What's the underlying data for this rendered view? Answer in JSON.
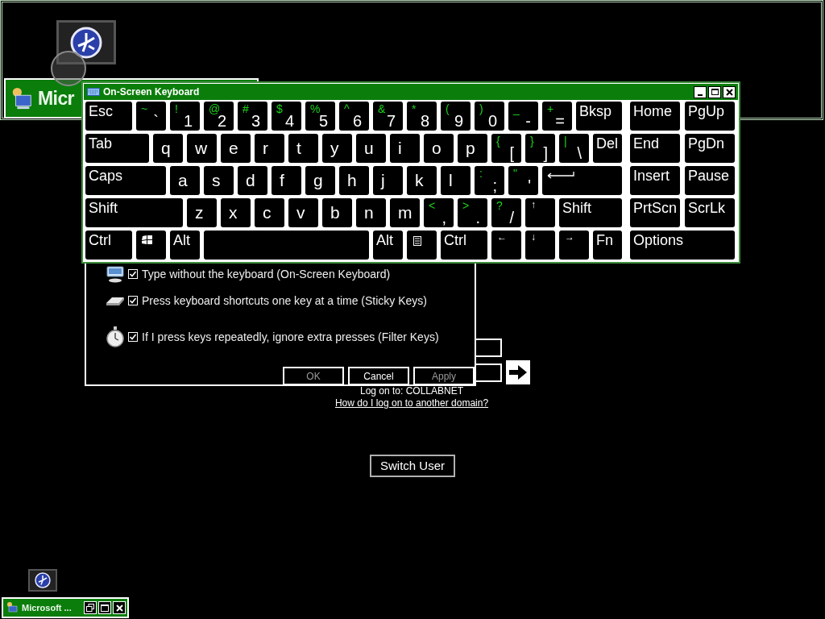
{
  "background_window": {
    "title": "Micr"
  },
  "keyboard": {
    "title": "On-Screen Keyboard",
    "rows": [
      {
        "keys": [
          {
            "kind": "label",
            "label": "Esc"
          },
          {
            "kind": "symbol",
            "shift": "~",
            "base": "`"
          },
          {
            "kind": "symbol",
            "shift": "!",
            "base": "1"
          },
          {
            "kind": "symbol",
            "shift": "@",
            "base": "2"
          },
          {
            "kind": "symbol",
            "shift": "#",
            "base": "3"
          },
          {
            "kind": "symbol",
            "shift": "$",
            "base": "4"
          },
          {
            "kind": "symbol",
            "shift": "%",
            "base": "5"
          },
          {
            "kind": "symbol",
            "shift": "^",
            "base": "6"
          },
          {
            "kind": "symbol",
            "shift": "&",
            "base": "7"
          },
          {
            "kind": "symbol",
            "shift": "*",
            "base": "8"
          },
          {
            "kind": "symbol",
            "shift": "(",
            "base": "9"
          },
          {
            "kind": "symbol",
            "shift": ")",
            "base": "0"
          },
          {
            "kind": "symbol",
            "shift": "_",
            "base": "-"
          },
          {
            "kind": "symbol",
            "shift": "+",
            "base": "="
          },
          {
            "kind": "label",
            "label": "Bksp"
          }
        ],
        "nav": [
          {
            "kind": "label",
            "label": "Home"
          },
          {
            "kind": "label",
            "label": "PgUp"
          }
        ]
      },
      {
        "keys": [
          {
            "kind": "label",
            "label": "Tab"
          },
          {
            "kind": "letter",
            "label": "q"
          },
          {
            "kind": "letter",
            "label": "w"
          },
          {
            "kind": "letter",
            "label": "e"
          },
          {
            "kind": "letter",
            "label": "r"
          },
          {
            "kind": "letter",
            "label": "t"
          },
          {
            "kind": "letter",
            "label": "y"
          },
          {
            "kind": "letter",
            "label": "u"
          },
          {
            "kind": "letter",
            "label": "i"
          },
          {
            "kind": "letter",
            "label": "o"
          },
          {
            "kind": "letter",
            "label": "p"
          },
          {
            "kind": "symbol",
            "shift": "{",
            "base": "["
          },
          {
            "kind": "symbol",
            "shift": "}",
            "base": "]"
          },
          {
            "kind": "symbol",
            "shift": "|",
            "base": "\\"
          },
          {
            "kind": "label",
            "label": "Del"
          }
        ],
        "nav": [
          {
            "kind": "label",
            "label": "End"
          },
          {
            "kind": "label",
            "label": "PgDn"
          }
        ]
      },
      {
        "keys": [
          {
            "kind": "label",
            "label": "Caps"
          },
          {
            "kind": "letter",
            "label": "a"
          },
          {
            "kind": "letter",
            "label": "s"
          },
          {
            "kind": "letter",
            "label": "d"
          },
          {
            "kind": "letter",
            "label": "f"
          },
          {
            "kind": "letter",
            "label": "g"
          },
          {
            "kind": "letter",
            "label": "h"
          },
          {
            "kind": "letter",
            "label": "j"
          },
          {
            "kind": "letter",
            "label": "k"
          },
          {
            "kind": "letter",
            "label": "l"
          },
          {
            "kind": "symbol",
            "shift": ":",
            "base": ";"
          },
          {
            "kind": "symbol",
            "shift": "\"",
            "base": "'"
          },
          {
            "kind": "enter"
          }
        ],
        "nav": [
          {
            "kind": "label",
            "label": "Insert"
          },
          {
            "kind": "label",
            "label": "Pause"
          }
        ]
      },
      {
        "keys": [
          {
            "kind": "label",
            "label": "Shift"
          },
          {
            "kind": "letter",
            "label": "z"
          },
          {
            "kind": "letter",
            "label": "x"
          },
          {
            "kind": "letter",
            "label": "c"
          },
          {
            "kind": "letter",
            "label": "v"
          },
          {
            "kind": "letter",
            "label": "b"
          },
          {
            "kind": "letter",
            "label": "n"
          },
          {
            "kind": "letter",
            "label": "m"
          },
          {
            "kind": "symbol",
            "shift": "<",
            "base": ","
          },
          {
            "kind": "symbol",
            "shift": ">",
            "base": "."
          },
          {
            "kind": "symbol",
            "shift": "?",
            "base": "/"
          },
          {
            "kind": "small",
            "label": "↑"
          },
          {
            "kind": "label",
            "label": "Shift"
          }
        ],
        "nav": [
          {
            "kind": "label",
            "label": "PrtScn"
          },
          {
            "kind": "label",
            "label": "ScrLk"
          }
        ]
      },
      {
        "keys": [
          {
            "kind": "label",
            "label": "Ctrl"
          },
          {
            "kind": "winlogo"
          },
          {
            "kind": "label",
            "label": "Alt"
          },
          {
            "kind": "space"
          },
          {
            "kind": "label",
            "label": "Alt"
          },
          {
            "kind": "menu"
          },
          {
            "kind": "label",
            "label": "Ctrl"
          },
          {
            "kind": "small",
            "label": "←"
          },
          {
            "kind": "small",
            "label": "↓"
          },
          {
            "kind": "small",
            "label": "→"
          },
          {
            "kind": "label",
            "label": "Fn"
          }
        ],
        "nav": [
          {
            "kind": "label",
            "label": "Options"
          }
        ]
      }
    ]
  },
  "ease_dialog": {
    "options": [
      {
        "kind": "keyboard",
        "label": "Type without the keyboard (On-Screen Keyboard)",
        "checked": true
      },
      {
        "kind": "sticky",
        "label": "Press keyboard shortcuts one key at a time (Sticky Keys)",
        "checked": true
      },
      {
        "kind": "timer",
        "label": "If I press keys repeatedly, ignore extra presses (Filter Keys)",
        "checked": true
      }
    ],
    "buttons": [
      {
        "label": "OK",
        "disabled": true
      },
      {
        "label": "Cancel",
        "disabled": false
      },
      {
        "label": "Apply",
        "disabled": true
      }
    ]
  },
  "logon": {
    "domain": "Log on to: COLLABNET",
    "link": "How do I log on to another domain?"
  },
  "switch_user": "Switch User",
  "taskbar_window": {
    "title": "Microsoft ..."
  }
}
